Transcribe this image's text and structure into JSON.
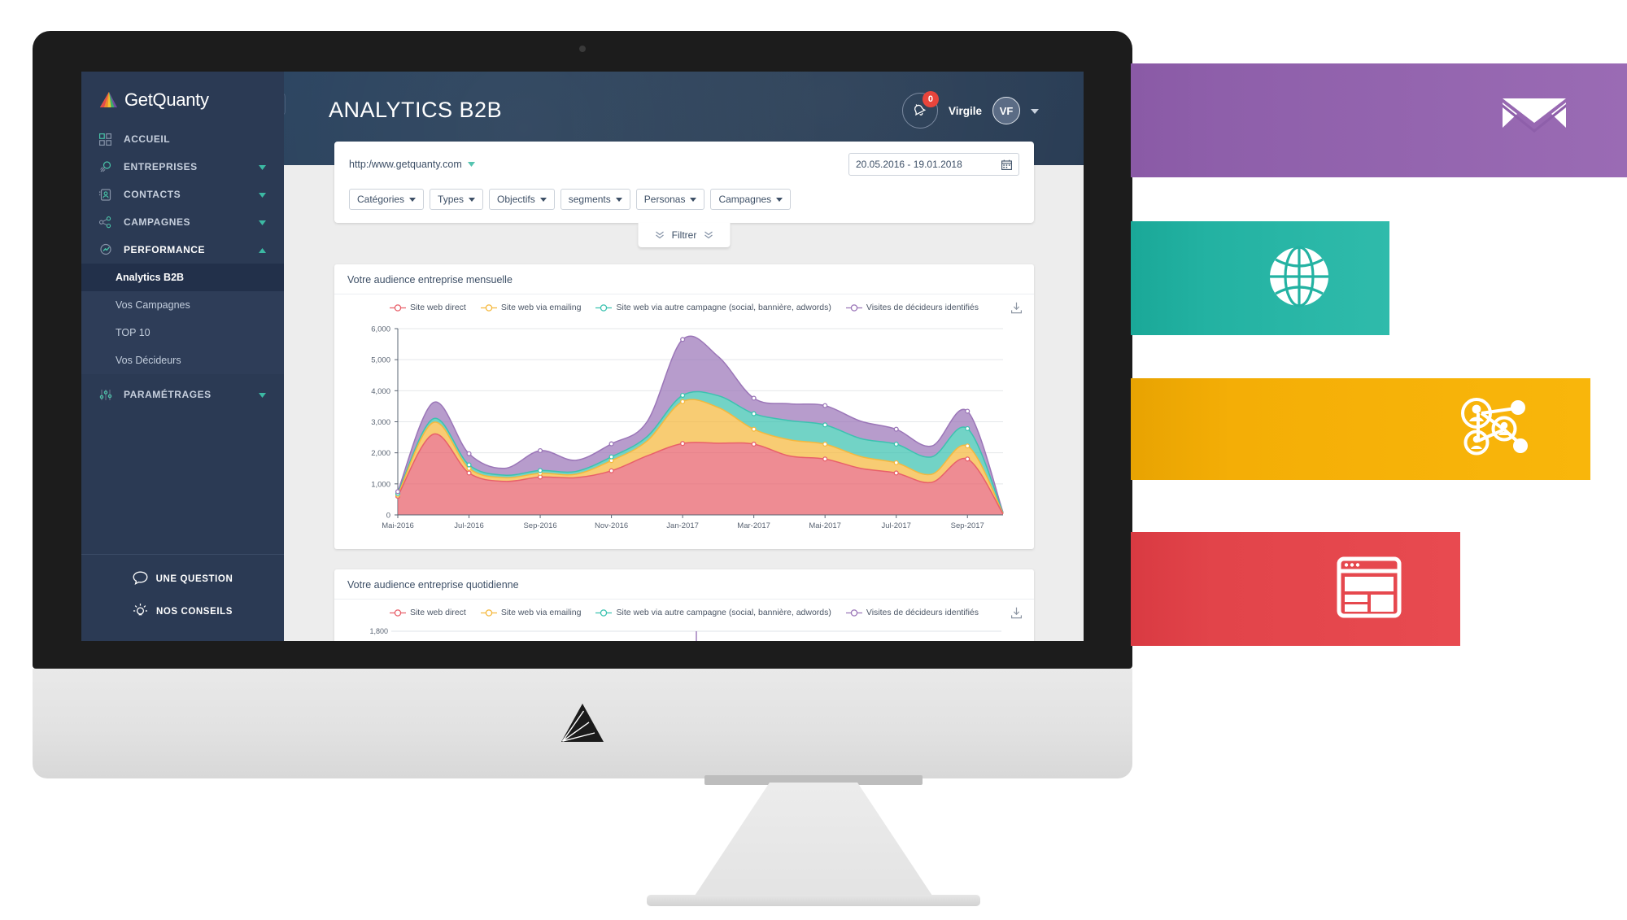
{
  "app": {
    "brand": "GetQuanty",
    "page_title": "ANALYTICS B2B"
  },
  "sidebar": {
    "collapse_icon": "chevron-left-icon",
    "items": [
      {
        "label": "ACCUEIL",
        "icon": "grid-icon",
        "caret": "",
        "expanded": false
      },
      {
        "label": "ENTREPRISES",
        "icon": "search-rocket-icon",
        "caret": "▼",
        "expanded": false
      },
      {
        "label": "CONTACTS",
        "icon": "contact-card-icon",
        "caret": "▼",
        "expanded": false
      },
      {
        "label": "CAMPAGNES",
        "icon": "network-icon",
        "caret": "▼",
        "expanded": false
      },
      {
        "label": "PERFORMANCE",
        "icon": "gauge-icon",
        "caret": "▲",
        "expanded": true
      },
      {
        "label": "PARAMÉTRAGES",
        "icon": "settings-icon",
        "caret": "▼",
        "expanded": false
      }
    ],
    "subitems": [
      {
        "label": "Analytics B2B",
        "current": true
      },
      {
        "label": "Vos Campagnes",
        "current": false
      },
      {
        "label": "TOP 10",
        "current": false
      },
      {
        "label": "Vos Décideurs",
        "current": false
      }
    ],
    "footer": [
      {
        "label": "UNE QUESTION",
        "icon": "speech-bubble-icon"
      },
      {
        "label": "NOS CONSEILS",
        "icon": "lightbulb-icon"
      }
    ]
  },
  "topbar": {
    "notifications_count": "0",
    "notifications_icon": "bell-icon",
    "user_name": "Virgile",
    "avatar_initials": "VF",
    "user_caret": "▼"
  },
  "filters": {
    "site_url": "http:/www.getquanty.com",
    "site_caret": "▼",
    "date_range": "20.05.2016 - 19.01.2018",
    "calendar_icon": "calendar-icon",
    "buttons": [
      {
        "label": "Catégories",
        "caret": "▼"
      },
      {
        "label": "Types",
        "caret": "▼"
      },
      {
        "label": "Objectifs",
        "caret": "▼"
      },
      {
        "label": "segments",
        "caret": "▼"
      },
      {
        "label": "Personas",
        "caret": "▼"
      },
      {
        "label": "Campagnes",
        "caret": "▼"
      }
    ],
    "filtrer_label": "Filtrer",
    "filtrer_icon": "chevrons-down-icon"
  },
  "cards": {
    "monthly_title": "Votre audience entreprise mensuelle",
    "daily_title": "Votre audience entreprise quotidienne",
    "download_icon": "download-icon"
  },
  "banners": [
    {
      "name": "emailing-banner",
      "icon": "envelope-icon",
      "color": "#8e5faa"
    },
    {
      "name": "website-banner",
      "icon": "globe-icon",
      "color": "#23b2a2"
    },
    {
      "name": "social-banner",
      "icon": "people-network-icon",
      "color": "#f4ae06"
    },
    {
      "name": "display-banner",
      "icon": "browser-layout-icon",
      "color": "#e2444a"
    }
  ],
  "chart_data": [
    {
      "type": "area",
      "id": "monthly",
      "title": "Votre audience entreprise mensuelle",
      "stacked": true,
      "grid": true,
      "legend_position": "top",
      "xlabel": "",
      "ylabel": "",
      "ylim": [
        0,
        6000
      ],
      "yticks": [
        "0",
        "1,000",
        "2,000",
        "3,000",
        "4,000",
        "5,000",
        "6,000"
      ],
      "xticks": [
        "Mai-2016",
        "Jul-2016",
        "Sep-2016",
        "Nov-2016",
        "Jan-2017",
        "Mar-2017",
        "Mai-2017",
        "Jul-2017",
        "Sep-2017"
      ],
      "x": [
        "Mai-2016",
        "Jun-2016",
        "Jul-2016",
        "Aou-2016",
        "Sep-2016",
        "Oct-2016",
        "Nov-2016",
        "Dec-2016",
        "Jan-2017",
        "Fev-2017",
        "Mar-2017",
        "Avr-2017",
        "Mai-2017",
        "Jun-2017",
        "Jul-2017",
        "Aou-2017",
        "Sep-2017",
        "Oct-2017"
      ],
      "series": [
        {
          "name": "Site web direct",
          "color": "#e8606a",
          "values": [
            600,
            2600,
            1350,
            1080,
            1220,
            1200,
            1420,
            1900,
            2300,
            2310,
            2280,
            1900,
            1800,
            1500,
            1350,
            1050,
            1800,
            30
          ]
        },
        {
          "name": "Site web via emailing",
          "color": "#f5b83d",
          "values": [
            40,
            380,
            150,
            120,
            120,
            110,
            330,
            480,
            1350,
            1150,
            480,
            520,
            480,
            380,
            330,
            260,
            420,
            15
          ]
        },
        {
          "name": "Site web via autre campagne (social, bannière, adwords)",
          "color": "#3cc2b0",
          "values": [
            50,
            120,
            110,
            80,
            90,
            90,
            120,
            140,
            200,
            380,
            500,
            620,
            620,
            580,
            600,
            560,
            560,
            15
          ]
        },
        {
          "name": "Visites de décideurs identifiés",
          "color": "#9b76b8",
          "values": [
            60,
            520,
            360,
            220,
            640,
            360,
            420,
            480,
            1800,
            1260,
            500,
            540,
            620,
            560,
            480,
            350,
            560,
            20
          ]
        }
      ]
    },
    {
      "type": "area",
      "id": "daily",
      "title": "Votre audience entreprise quotidienne",
      "stacked": true,
      "grid": true,
      "legend_position": "top",
      "ylim": [
        0,
        1800
      ],
      "yticks": [
        "1,800"
      ],
      "series": [
        {
          "name": "Site web direct",
          "color": "#e8606a"
        },
        {
          "name": "Site web via emailing",
          "color": "#f5b83d"
        },
        {
          "name": "Site web via autre campagne (social, bannière, adwords)",
          "color": "#3cc2b0"
        },
        {
          "name": "Visites de décideurs identifiés",
          "color": "#9b76b8"
        }
      ]
    }
  ]
}
